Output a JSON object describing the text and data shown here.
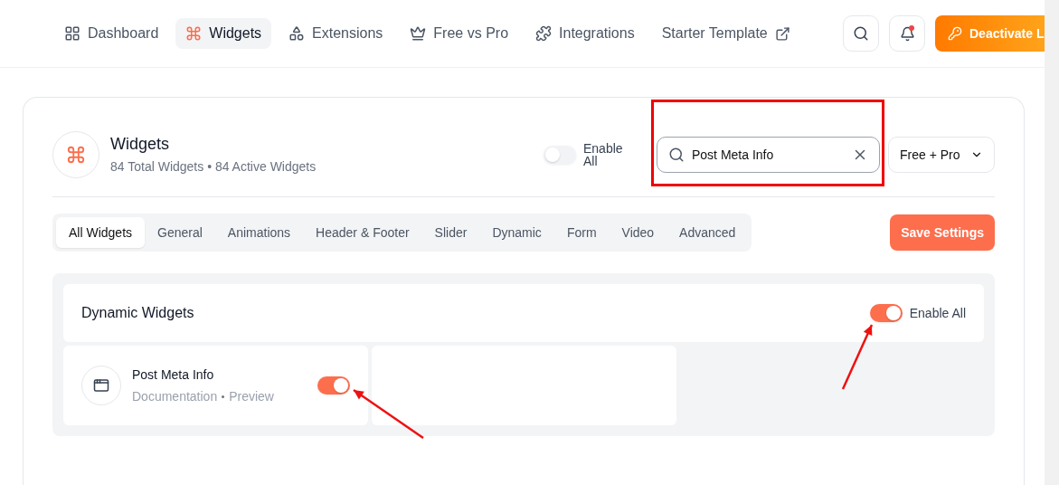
{
  "nav": {
    "items": [
      {
        "label": "Dashboard",
        "selected": false,
        "external": false
      },
      {
        "label": "Widgets",
        "selected": true,
        "external": false
      },
      {
        "label": "Extensions",
        "selected": false,
        "external": false
      },
      {
        "label": "Free vs Pro",
        "selected": false,
        "external": false
      },
      {
        "label": "Integrations",
        "selected": false,
        "external": false
      },
      {
        "label": "Starter Template",
        "selected": false,
        "external": true
      }
    ],
    "notification_dot": true,
    "action_button": "Deactivate L"
  },
  "header": {
    "title": "Widgets",
    "subtitle": "84 Total Widgets • 84 Active Widgets",
    "enable_all": {
      "label": "Enable All",
      "on": false
    },
    "search": {
      "value": "Post Meta Info"
    },
    "filter": "Free + Pro"
  },
  "tabs": [
    {
      "label": "All Widgets",
      "selected": true
    },
    {
      "label": "General",
      "selected": false
    },
    {
      "label": "Animations",
      "selected": false
    },
    {
      "label": "Header & Footer",
      "selected": false
    },
    {
      "label": "Slider",
      "selected": false
    },
    {
      "label": "Dynamic",
      "selected": false
    },
    {
      "label": "Form",
      "selected": false
    },
    {
      "label": "Video",
      "selected": false
    },
    {
      "label": "Advanced",
      "selected": false
    }
  ],
  "save_button": "Save Settings",
  "section": {
    "title": "Dynamic Widgets",
    "enable_all": {
      "label": "Enable All",
      "on": true
    },
    "widgets": [
      {
        "name": "Post Meta Info",
        "links": [
          "Documentation",
          "Preview"
        ],
        "on": true
      }
    ]
  }
}
